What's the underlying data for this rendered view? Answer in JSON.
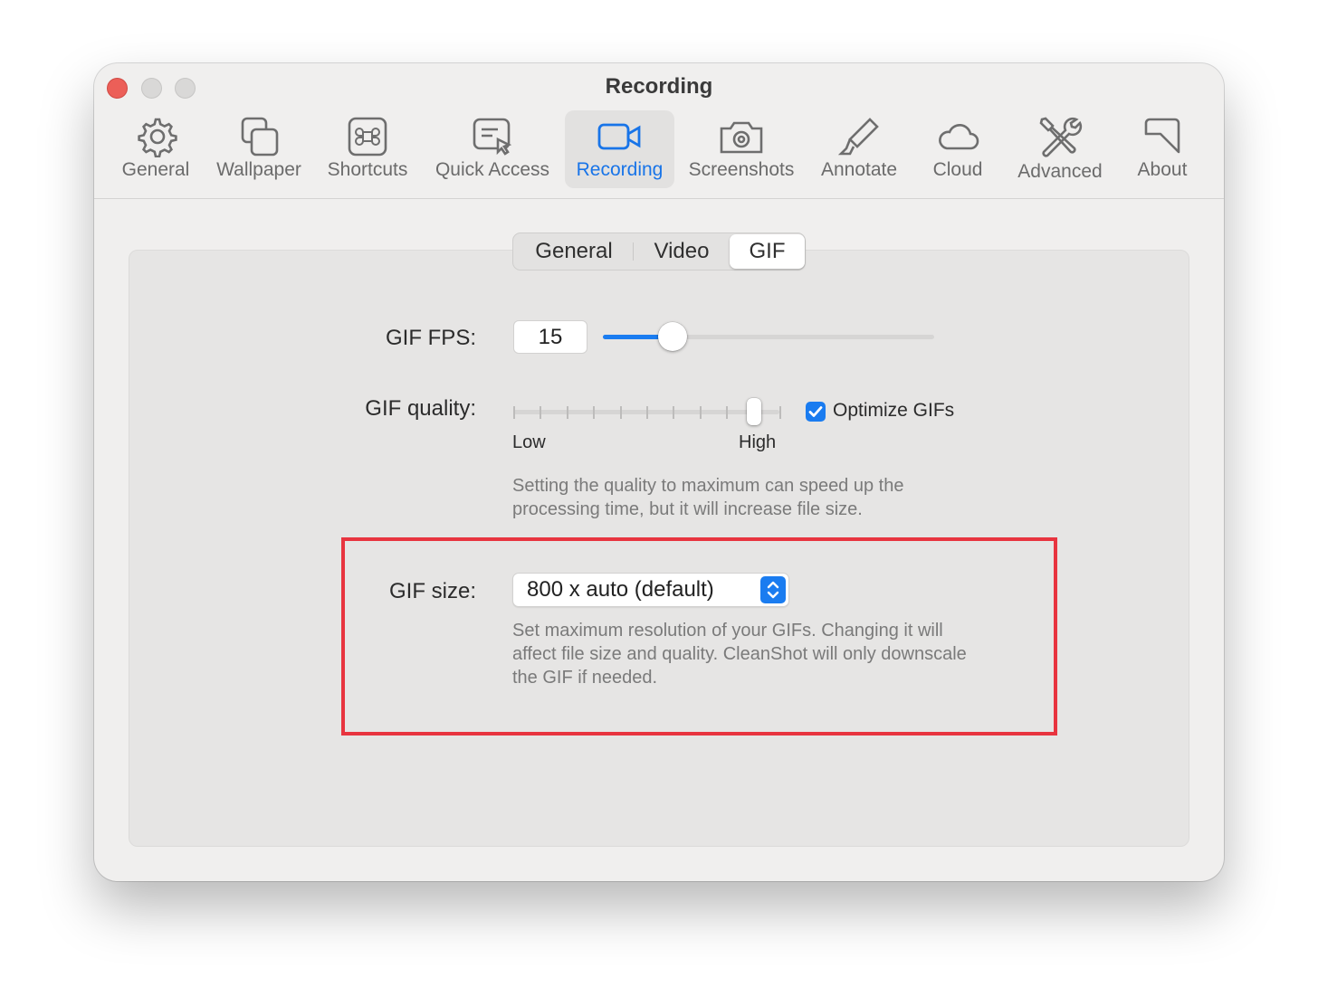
{
  "window": {
    "title": "Recording",
    "controls": [
      "close",
      "minimize",
      "zoom"
    ]
  },
  "toolbar": {
    "items": [
      {
        "label": "General",
        "icon": "gear-icon"
      },
      {
        "label": "Wallpaper",
        "icon": "wallpaper-icon"
      },
      {
        "label": "Shortcuts",
        "icon": "command-key-icon"
      },
      {
        "label": "Quick Access",
        "icon": "quick-access-icon"
      },
      {
        "label": "Recording",
        "icon": "video-camera-icon",
        "active": true
      },
      {
        "label": "Screenshots",
        "icon": "camera-icon"
      },
      {
        "label": "Annotate",
        "icon": "highlighter-icon"
      },
      {
        "label": "Cloud",
        "icon": "cloud-icon"
      },
      {
        "label": "Advanced",
        "icon": "tools-icon"
      },
      {
        "label": "About",
        "icon": "about-icon"
      }
    ]
  },
  "tabs": {
    "items": [
      "General",
      "Video",
      "GIF"
    ],
    "selected": "GIF"
  },
  "gif_fps": {
    "label": "GIF FPS:",
    "value": "15",
    "slider_fraction": 0.21
  },
  "gif_quality": {
    "label": "GIF quality:",
    "low_label": "Low",
    "high_label": "High",
    "tick_count": 11,
    "selected_step": 9,
    "optimize_label": "Optimize GIFs",
    "optimize_checked": true,
    "help": "Setting the quality to maximum can speed up the processing time, but it will increase file size."
  },
  "gif_size": {
    "label": "GIF size:",
    "value": "800 x auto (default)",
    "help": "Set maximum resolution of your GIFs. Changing it will affect file size and quality. CleanShot will only downscale the GIF if needed."
  },
  "colors": {
    "accent": "#1a7cf0",
    "highlight_box": "#e8343f",
    "close_button": "#ec5f58"
  }
}
